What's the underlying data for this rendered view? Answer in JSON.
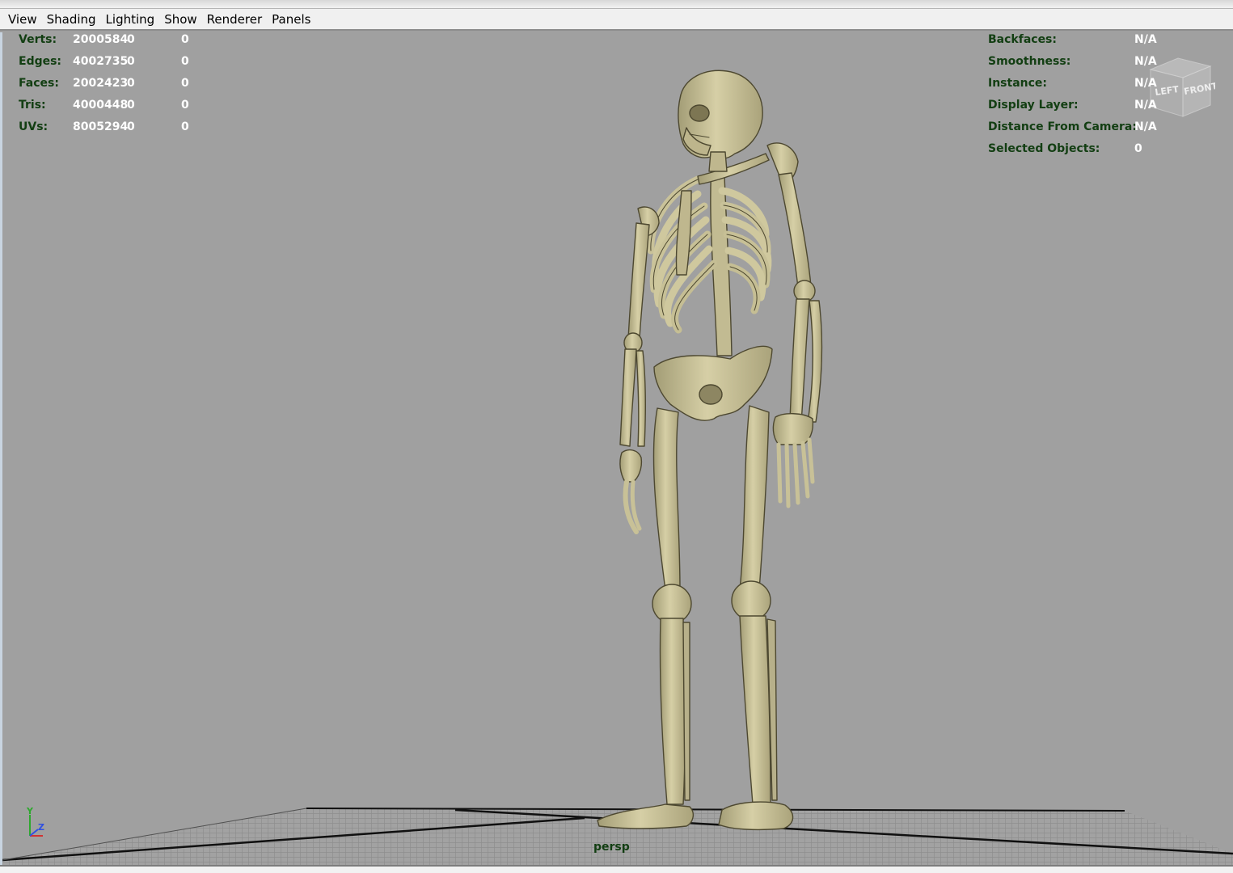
{
  "menubar": {
    "items": [
      "View",
      "Shading",
      "Lighting",
      "Show",
      "Renderer",
      "Panels"
    ]
  },
  "hud_left": {
    "rows": [
      {
        "label": "Verts:",
        "values": [
          "2000584",
          "0",
          "0"
        ]
      },
      {
        "label": "Edges:",
        "values": [
          "4002735",
          "0",
          "0"
        ]
      },
      {
        "label": "Faces:",
        "values": [
          "2002423",
          "0",
          "0"
        ]
      },
      {
        "label": "Tris:",
        "values": [
          "4000448",
          "0",
          "0"
        ]
      },
      {
        "label": "UVs:",
        "values": [
          "8005294",
          "0",
          "0"
        ]
      }
    ]
  },
  "hud_right": {
    "rows": [
      {
        "label": "Backfaces:",
        "value": "N/A"
      },
      {
        "label": "Smoothness:",
        "value": "N/A"
      },
      {
        "label": "Instance:",
        "value": "N/A"
      },
      {
        "label": "Display Layer:",
        "value": "N/A"
      },
      {
        "label": "Distance From Camera:",
        "value": "N/A"
      },
      {
        "label": "Selected Objects:",
        "value": "0"
      }
    ]
  },
  "view_cube": {
    "left_face": "LEFT",
    "front_face": "FRONT"
  },
  "axis_gizmo": {
    "y_label": "Y",
    "z_label": "Z"
  },
  "camera": {
    "name": "persp"
  },
  "colors": {
    "viewport_bg": "#a0a0a0",
    "hud_label": "#123e12",
    "hud_value": "#ffffff",
    "bone": "#cfc79d",
    "bone_shadow": "#6b6442"
  },
  "scene": {
    "object": "skeleton-model",
    "grid": true
  }
}
